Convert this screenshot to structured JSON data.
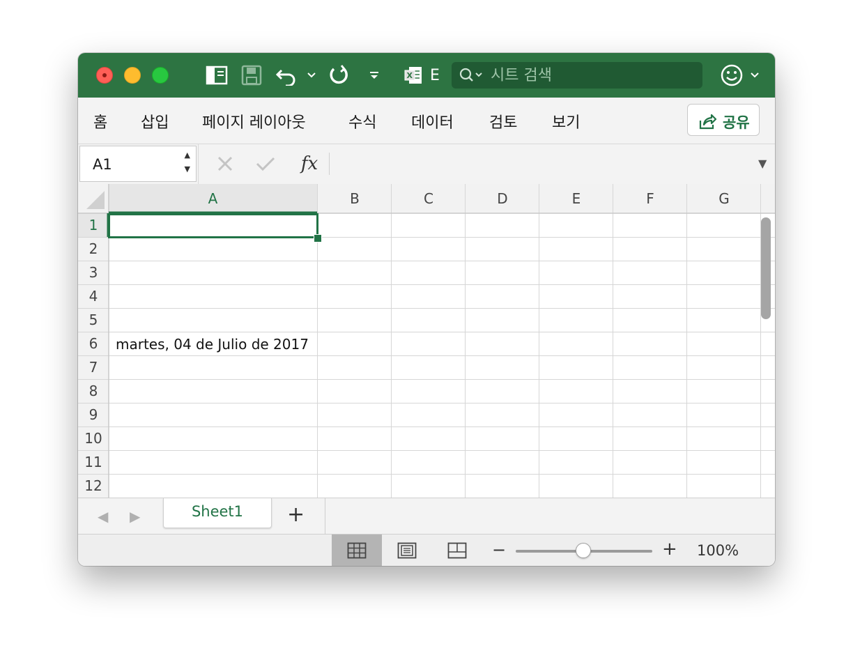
{
  "titlebar": {
    "search_placeholder": "시트 검색",
    "truncated_title": "E"
  },
  "ribbon": {
    "tabs": [
      "홈",
      "삽입",
      "페이지 레이아웃",
      "수식",
      "데이터",
      "검토",
      "보기"
    ],
    "share_label": "공유"
  },
  "formula_bar": {
    "name_box": "A1",
    "fx_label": "fx",
    "formula": ""
  },
  "sheet": {
    "columns": [
      "A",
      "B",
      "C",
      "D",
      "E",
      "F",
      "G"
    ],
    "rows": [
      "1",
      "2",
      "3",
      "4",
      "5",
      "6",
      "7",
      "8",
      "9",
      "10",
      "11",
      "12"
    ],
    "selected_cell": "A1",
    "cells": {
      "A6": "martes, 04 de Julio de 2017"
    }
  },
  "sheet_tabs": {
    "active": "Sheet1",
    "add_label": "+"
  },
  "status_bar": {
    "zoom": "100%",
    "zoom_fraction": 0.5
  },
  "colors": {
    "accent": "#217346",
    "titlebar": "#2d7442"
  },
  "icons": [
    "sidebar-toggle-icon",
    "save-icon",
    "undo-icon",
    "chevron-down-icon",
    "redo-icon",
    "customize-toolbar-icon",
    "excel-doc-icon",
    "search-icon",
    "smiley-feedback-icon",
    "share-icon",
    "cancel-icon",
    "confirm-icon",
    "normal-view-icon",
    "page-layout-view-icon",
    "page-break-view-icon"
  ]
}
